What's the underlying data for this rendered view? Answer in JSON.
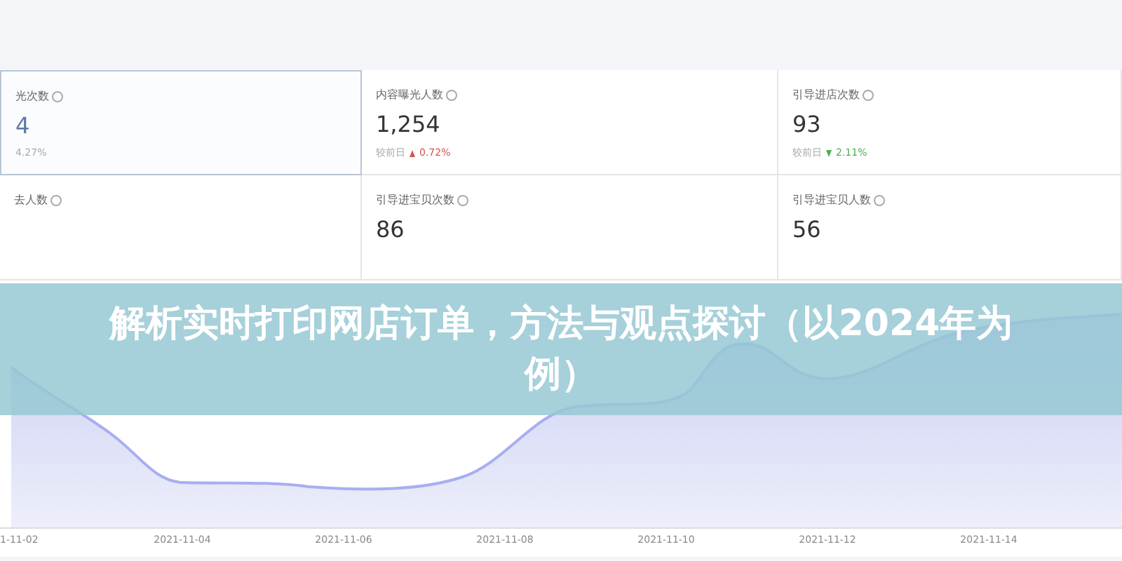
{
  "cards": [
    {
      "label": "光次数",
      "value": "4",
      "delta_value": "4.27%",
      "selected": true
    },
    {
      "label": "内容曝光人数",
      "value": "1,254",
      "delta_prefix": "较前日",
      "rising": true,
      "delta_value": "0.72%",
      "selected": false
    },
    {
      "label": "引导进店次数",
      "value": "93",
      "delta_prefix": "较前日",
      "rising": false,
      "delta_value": "2.11%",
      "selected": false
    },
    {
      "label": "去人数",
      "selected": false
    },
    {
      "label": "引导进宝贝次数",
      "value": "86",
      "selected": false
    },
    {
      "label": "引导进宝贝人数",
      "value": "56",
      "selected": false
    }
  ],
  "chart": {
    "x_labels": [
      "1-11-02",
      "2021-11-04",
      "2021-11-06",
      "2021-11-08",
      "2021-11-10",
      "2021-11-12",
      "2021-11-14"
    ]
  },
  "banner": {
    "title": "解析实时打印网店订单，方法与观点探讨（以2024年为例）"
  }
}
